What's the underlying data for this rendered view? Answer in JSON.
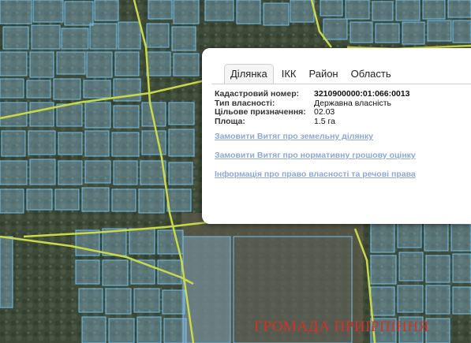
{
  "popup": {
    "tabs": [
      {
        "label": "Ділянка",
        "active": true
      },
      {
        "label": "ІКК",
        "active": false
      },
      {
        "label": "Район",
        "active": false
      },
      {
        "label": "Область",
        "active": false
      }
    ],
    "fields": [
      {
        "label": "Кадастровий номер:",
        "value": "3210900000:01:066:0013"
      },
      {
        "label": "Тип власності:",
        "value": "Державна власність"
      },
      {
        "label": "Цільове призначення:",
        "value": "02.03"
      },
      {
        "label": "Площа:",
        "value": "1.5 га"
      }
    ],
    "links": [
      "Замовити Витяг про земельну ділянку",
      "Замовити Витяг про нормативну грошову оцінку",
      "Інформація про право власності та речові права"
    ]
  },
  "watermark": "ГРОМАДА ПРИІРПІННЯ",
  "colors": {
    "parcel_fill": "#8fc6ee",
    "parcel_stroke": "#5fb4ee",
    "road": "#c9d94a",
    "link": "#8ea7d6",
    "watermark": "#d0332b"
  }
}
